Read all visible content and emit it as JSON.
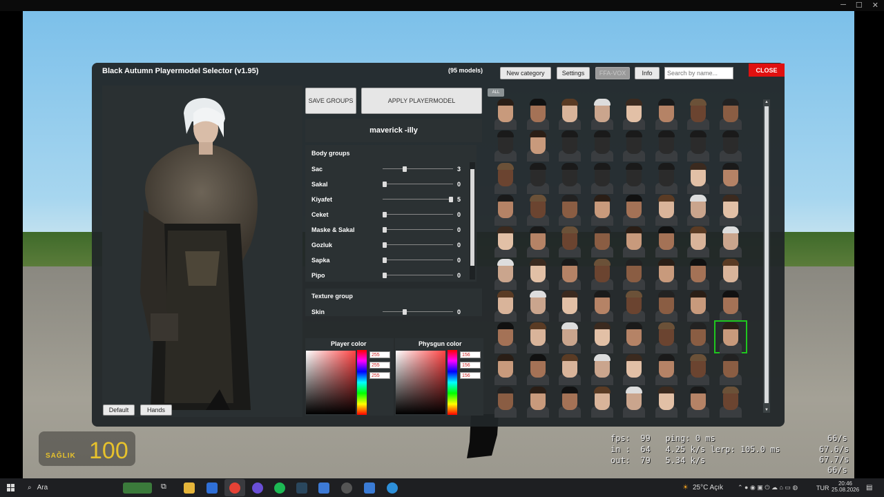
{
  "window": {
    "controls": [
      "─",
      "☐",
      "✕"
    ]
  },
  "selector": {
    "title": "Black Autumn Playermodel Selector (v1.95)",
    "model_count": "(95 models)",
    "buttons": {
      "new_category": "New category",
      "settings": "Settings",
      "ffa_vox": "FFA-VOX",
      "info": "Info",
      "close": "CLOSE",
      "save_groups": "SAVE GROUPS",
      "apply_playermodel": "APPLY PLAYERMODEL",
      "default": "Default",
      "hands": "Hands",
      "all": "ALL"
    },
    "search_placeholder": "Search by name...",
    "model_name": "maverick -illy",
    "body_groups_title": "Body groups",
    "body_groups": [
      {
        "label": "Sac",
        "value": "3",
        "fraction": 0.3
      },
      {
        "label": "Sakal",
        "value": "0",
        "fraction": 0.0
      },
      {
        "label": "Kiyafet",
        "value": "5",
        "fraction": 1.0
      },
      {
        "label": "Ceket",
        "value": "0",
        "fraction": 0.0
      },
      {
        "label": "Maske & Sakal",
        "value": "0",
        "fraction": 0.0
      },
      {
        "label": "Gozluk",
        "value": "0",
        "fraction": 0.0
      },
      {
        "label": "Sapka",
        "value": "0",
        "fraction": 0.0
      },
      {
        "label": "Pipo",
        "value": "0",
        "fraction": 0.0
      }
    ],
    "texture_group_title": "Texture group",
    "texture_group": {
      "label": "Skin",
      "value": "0",
      "fraction": 0.3
    },
    "player_color": {
      "title": "Player color",
      "r": "255",
      "g": "255",
      "b": "255"
    },
    "physgun_color": {
      "title": "Physgun color",
      "r": "156",
      "g": "156",
      "b": "156"
    }
  },
  "hud": {
    "health_label": "SAĞLIK",
    "health_value": "100"
  },
  "netgraph": {
    "line1": "fps:  99   ping: 0 ms",
    "line2": "in :  64   4.25 k/s lerp: 105.0 ms",
    "line3": "out:  79   5.34 k/s",
    "right1": "66/s",
    "right2": "67.6/s",
    "right3": "67.7/s",
    "right4": "66/s"
  },
  "taskbar": {
    "search": "Ara",
    "weather": "25°C  Açık",
    "lang": "TUR",
    "time": "20:46",
    "date": "25.08.2026"
  }
}
